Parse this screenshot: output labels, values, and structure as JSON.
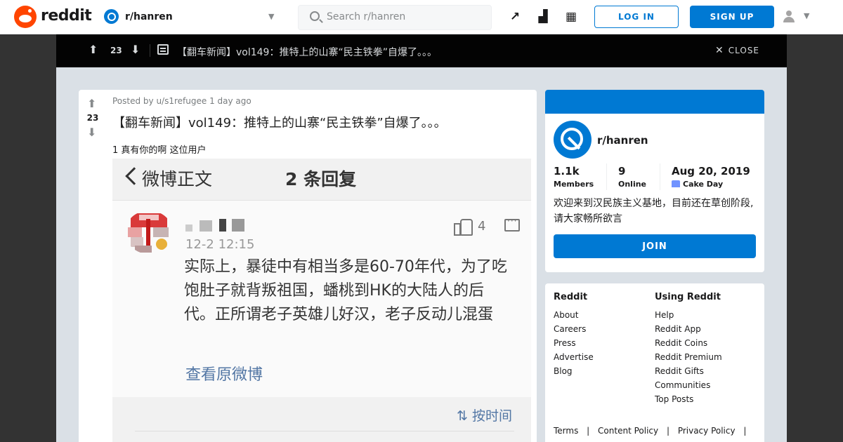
{
  "header": {
    "wordmark": "reddit",
    "subreddit": "r/hanren",
    "search_placeholder": "Search r/hanren",
    "login_label": "LOG IN",
    "signup_label": "SIGN UP",
    "icons": [
      "trending-icon",
      "stats-icon",
      "coins-icon",
      "user-icon"
    ]
  },
  "topbar": {
    "score": "23",
    "title": "【翻车新闻】vol149：推特上的山寨“民主铁拳”自爆了。。。",
    "close_label": "CLOSE"
  },
  "post": {
    "score": "23",
    "posted_by": "Posted by u/s1refugee 1 day ago",
    "title": "【翻车新闻】vol149：推特上的山寨“民主铁拳”自爆了。。。",
    "body": "1 真有你的啊 这位用户",
    "screenshot": {
      "header_title": "微博正文",
      "reply_count": "2 条回复",
      "time": "12-2 12:15",
      "like_count": "4",
      "text": "实际上，暴徒中有相当多是60-70年代，为了吃饱肚子就背叛祖国，蟠桃到HK的大陆人的后代。正所谓老子英雄儿好汉，老子反动儿混蛋",
      "link": "查看原微博",
      "sort_label": "按时间"
    }
  },
  "community": {
    "name": "r/hanren",
    "members_value": "1.1k",
    "members_label": "Members",
    "online_value": "9",
    "online_label": "Online",
    "cake_value": "Aug 20, 2019",
    "cake_label": "Cake Day",
    "description": "欢迎来到汉民族主义基地，目前还在草创阶段,请大家畅所欲言",
    "join_label": "JOIN",
    "brand_color": "#0079d3"
  },
  "footer": {
    "col1_title": "Reddit",
    "col1_items": [
      "About",
      "Careers",
      "Press",
      "Advertise",
      "Blog"
    ],
    "col2_title": "Using Reddit",
    "col2_items": [
      "Help",
      "Reddit App",
      "Reddit Coins",
      "Reddit Premium",
      "Reddit Gifts",
      "Communities",
      "Top Posts"
    ],
    "legal": [
      "Terms",
      "|",
      "Content Policy",
      "|",
      "Privacy Policy",
      "|"
    ]
  }
}
